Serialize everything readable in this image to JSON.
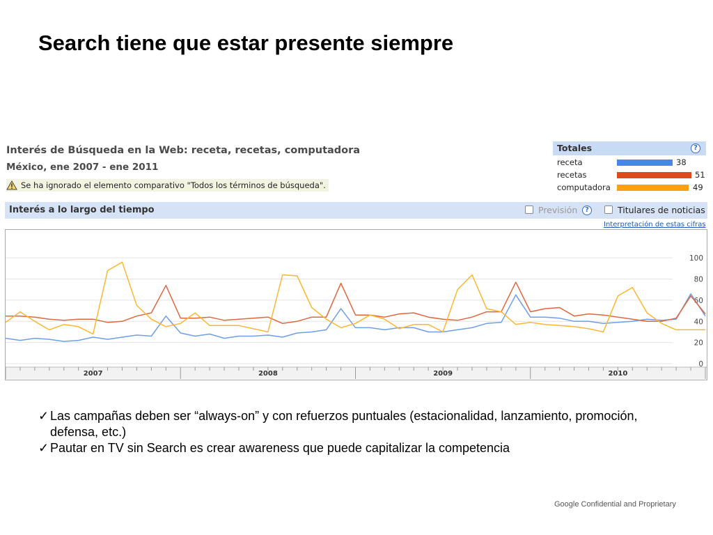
{
  "slide": {
    "title": "Search tiene que estar presente siempre",
    "bullets": [
      "Las campañas deben ser “always-on” y con refuerzos puntuales (estacionalidad, lanzamiento, promoción, defensa, etc.)",
      "Pautar en TV sin Search es crear awareness que puede capitalizar la competencia"
    ],
    "check_symbol": "✓",
    "footer": "Google Confidential and Proprietary"
  },
  "trends": {
    "title": "Interés de Búsqueda en la Web: receta, recetas, computadora",
    "subtitle": "México, ene 2007 - ene 2011",
    "warning": "Se ha ignorado el elemento comparativo \"Todos los términos de búsqueda\".",
    "totals": {
      "title": "Totales",
      "help": "?",
      "rows": [
        {
          "label": "receta",
          "value": "38",
          "color": "#4a86e8"
        },
        {
          "label": "recetas",
          "value": "51",
          "color": "#dc4b1c"
        },
        {
          "label": "computadora",
          "value": "49",
          "color": "#fba015"
        }
      ]
    },
    "section": {
      "label": "Interés a lo largo del tiempo",
      "forecast_label": "Previsión",
      "help": "?",
      "news_label": "Titulares de noticias"
    },
    "interpretation_link": "Interpretación de estas cifras"
  },
  "chart_data": {
    "type": "line",
    "ylim": [
      0,
      110
    ],
    "yticks": [
      "0",
      "20",
      "40",
      "60",
      "80",
      "100"
    ],
    "xticks": [
      "2007",
      "2008",
      "2009",
      "2010"
    ],
    "grid": true,
    "series": [
      {
        "name": "receta",
        "color": "#6d9eeb",
        "values": [
          24,
          22,
          24,
          23,
          21,
          22,
          25,
          23,
          25,
          27,
          26,
          45,
          29,
          26,
          28,
          24,
          26,
          26,
          27,
          25,
          29,
          30,
          32,
          52,
          34,
          34,
          32,
          34,
          34,
          30,
          30,
          32,
          34,
          38,
          39,
          65,
          44,
          44,
          43,
          40,
          40,
          38,
          39,
          40,
          42,
          41,
          42,
          66,
          45
        ]
      },
      {
        "name": "recetas",
        "color": "#e0663d",
        "values": [
          45,
          45,
          44,
          42,
          41,
          42,
          42,
          39,
          40,
          45,
          48,
          74,
          43,
          43,
          44,
          41,
          42,
          43,
          44,
          38,
          40,
          44,
          44,
          76,
          46,
          46,
          44,
          47,
          48,
          44,
          42,
          41,
          44,
          49,
          49,
          77,
          49,
          52,
          53,
          45,
          47,
          46,
          44,
          42,
          40,
          40,
          43,
          64,
          47
        ]
      },
      {
        "name": "computadora",
        "color": "#fbb72e",
        "values": [
          39,
          49,
          40,
          32,
          37,
          35,
          28,
          88,
          96,
          55,
          42,
          35,
          38,
          48,
          36,
          36,
          36,
          33,
          30,
          84,
          83,
          53,
          42,
          34,
          38,
          46,
          42,
          33,
          37,
          37,
          30,
          70,
          84,
          52,
          49,
          37,
          39,
          37,
          36,
          35,
          33,
          30,
          64,
          72,
          48,
          38,
          32,
          32,
          32
        ]
      }
    ]
  }
}
